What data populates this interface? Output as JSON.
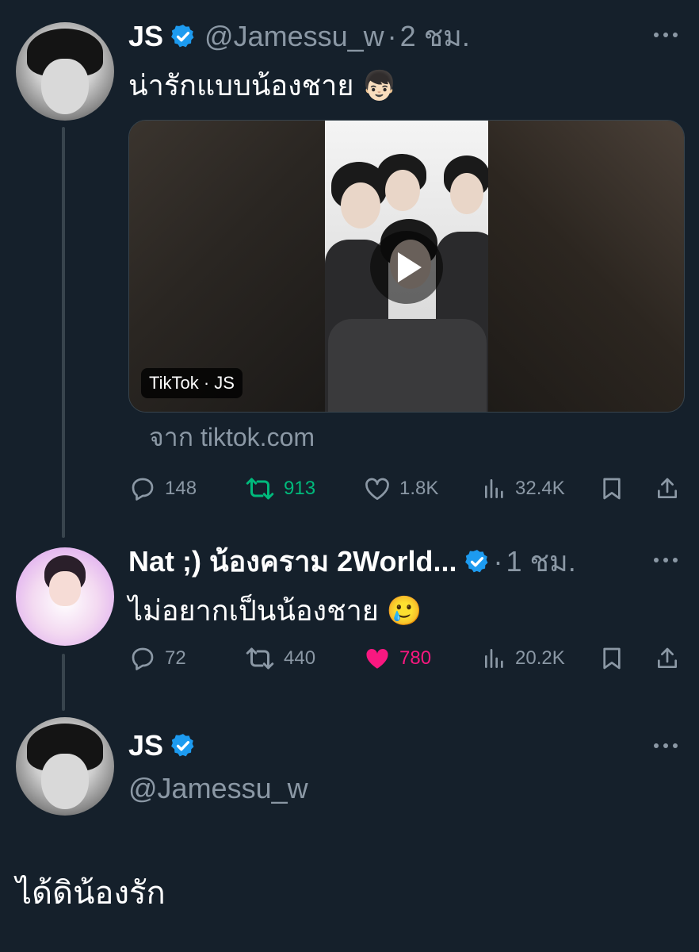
{
  "tweets": [
    {
      "name": "JS",
      "handle": "@Jamessu_w",
      "time": "2 ชม.",
      "text": "น่ารักแบบน้องชาย",
      "emoji": "👦🏻",
      "media_label": "TikTok · JS",
      "source": "จาก tiktok.com",
      "replies": "148",
      "retweets": "913",
      "likes": "1.8K",
      "views": "32.4K"
    },
    {
      "name": "Nat ;) น้องคราม 2World...",
      "time": "1 ชม.",
      "text": "ไม่อยากเป็นน้องชาย",
      "emoji": "🥲",
      "replies": "72",
      "retweets": "440",
      "likes": "780",
      "views": "20.2K"
    },
    {
      "name": "JS",
      "handle": "@Jamessu_w",
      "text": "ได้ดิน้องรัก"
    }
  ],
  "colors": {
    "background": "#15202b",
    "muted": "#8b98a5",
    "verified": "#1d9bf0",
    "retweet_active": "#00ba7c",
    "like_active": "#f91880"
  },
  "icons": [
    "verified-badge-icon",
    "more-icon",
    "reply-icon",
    "retweet-icon",
    "like-icon",
    "views-icon",
    "bookmark-icon",
    "share-icon",
    "play-icon"
  ]
}
